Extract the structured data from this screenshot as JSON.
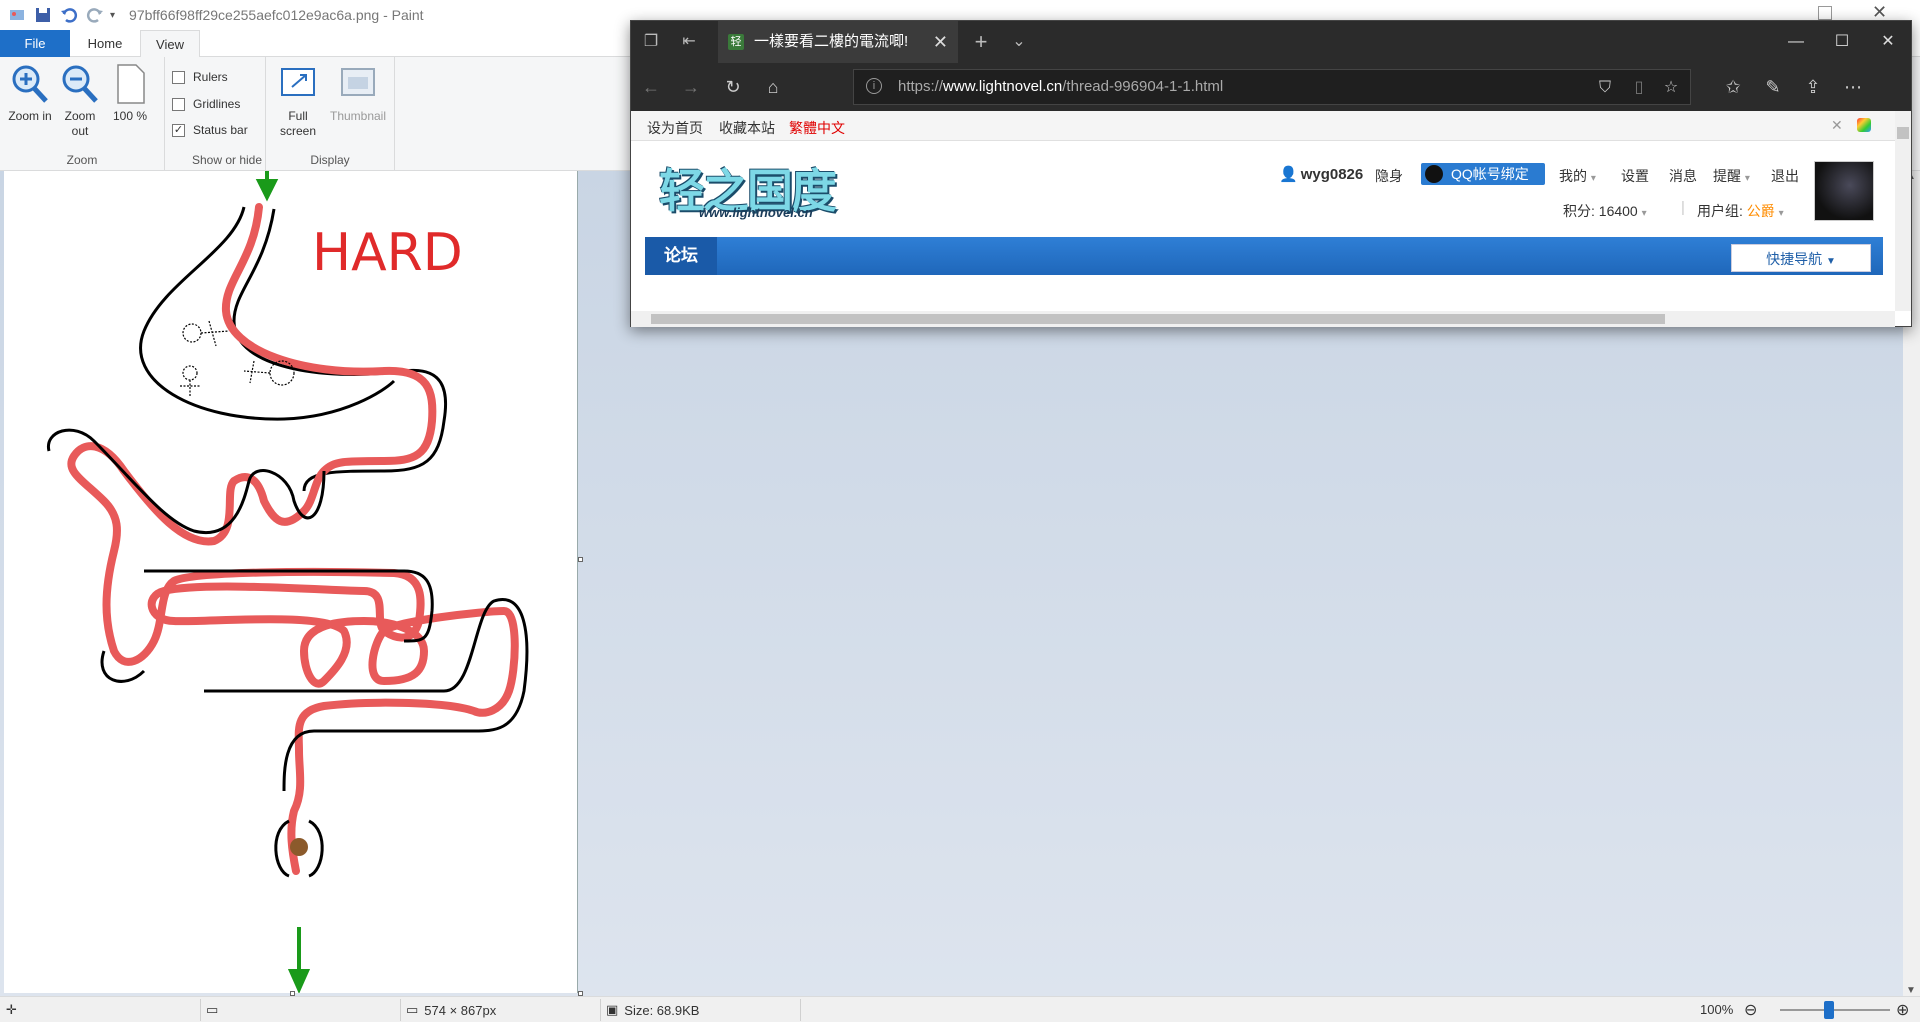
{
  "paint": {
    "title": "97bff66f98ff29ce255aefc012e9ac6a.png - Paint",
    "tabs": {
      "file": "File",
      "home": "Home",
      "view": "View"
    },
    "zoom_group": {
      "label": "Zoom",
      "zoom_in": "Zoom in",
      "zoom_out": "Zoom out",
      "hundred": "100 %"
    },
    "show_hide_group": {
      "label": "Show or hide",
      "rulers": "Rulers",
      "gridlines": "Gridlines",
      "status_bar": "Status bar",
      "rulers_checked": false,
      "gridlines_checked": false,
      "status_bar_checked": true
    },
    "display_group": {
      "label": "Display",
      "full_screen": "Full screen",
      "thumbnail": "Thumbnail"
    },
    "canvas_text": "HARD",
    "status": {
      "dimensions": "574 × 867px",
      "size": "Size: 68.9KB",
      "zoom": "100%"
    }
  },
  "edge": {
    "tab_title": "一樣要看二樓的電流唧!",
    "tab_favicon": "轻",
    "url_prefix": "https://",
    "url_domain": "www.lightnovel.cn",
    "url_path": "/thread-996904-1-1.html",
    "site": {
      "topbar": [
        "设为首页",
        "收藏本站",
        "繁體中文"
      ],
      "logo_main": "轻之国度",
      "logo_sub": "www.lightnovel.cn",
      "username": "wyg0826",
      "invisible": "隐身",
      "qq_bind": "QQ帐号绑定",
      "menu": [
        "我的",
        "设置",
        "消息",
        "提醒",
        "退出"
      ],
      "points_label": "积分: 16400",
      "usergroup_label": "用户组:",
      "usergroup_value": "公爵",
      "nav_forum": "论坛",
      "quick_nav": "快捷导航"
    }
  },
  "colors": {
    "accent": "#1e6fc8",
    "maze_path": "#e85a5a",
    "hard_text": "#e02a2a",
    "arrow": "#1a9a1a",
    "topbar_highlight": "#e00000",
    "usergroup": "#ff8c00"
  },
  "icons": [
    "save-icon",
    "undo-icon",
    "redo-icon",
    "zoom-in-icon",
    "zoom-out-icon",
    "full-screen-icon",
    "thumbnail-icon",
    "back-icon",
    "forward-icon",
    "refresh-icon",
    "home-icon",
    "favorite-icon",
    "reading-list-icon",
    "pen-icon",
    "share-icon",
    "more-icon"
  ]
}
